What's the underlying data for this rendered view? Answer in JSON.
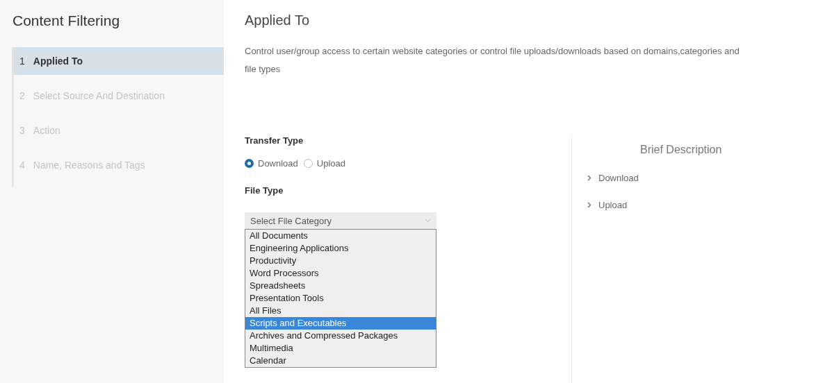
{
  "sidebar": {
    "title": "Content Filtering",
    "steps": [
      {
        "number": "1",
        "label": "Applied To",
        "selected": true
      },
      {
        "number": "2",
        "label": "Select Source And Destination",
        "selected": false
      },
      {
        "number": "3",
        "label": "Action",
        "selected": false
      },
      {
        "number": "4",
        "label": "Name, Reasons and Tags",
        "selected": false
      }
    ]
  },
  "main": {
    "title": "Applied To",
    "description": "Control user/group access to certain website categories or control file uploads/downloads based on domains,categories and file types",
    "transfer_type": {
      "label": "Transfer Type",
      "options": [
        {
          "label": "Download",
          "selected": true
        },
        {
          "label": "Upload",
          "selected": false
        }
      ]
    },
    "file_type": {
      "label": "File Type",
      "placeholder": "Select File Category",
      "options": [
        {
          "label": "All Documents",
          "selected": false
        },
        {
          "label": "Engineering Applications",
          "selected": false
        },
        {
          "label": "Productivity",
          "selected": false
        },
        {
          "label": "Word Processors",
          "selected": false
        },
        {
          "label": "Spreadsheets",
          "selected": false
        },
        {
          "label": "Presentation Tools",
          "selected": false
        },
        {
          "label": "All Files",
          "selected": false
        },
        {
          "label": "Scripts and Executables",
          "selected": true
        },
        {
          "label": "Archives and Compressed Packages",
          "selected": false
        },
        {
          "label": "Multimedia",
          "selected": false
        },
        {
          "label": "Calendar",
          "selected": false
        }
      ]
    }
  },
  "brief_description": {
    "title": "Brief Description",
    "items": [
      {
        "label": "Download",
        "expanded": false
      },
      {
        "label": "Upload",
        "expanded": false
      }
    ]
  }
}
